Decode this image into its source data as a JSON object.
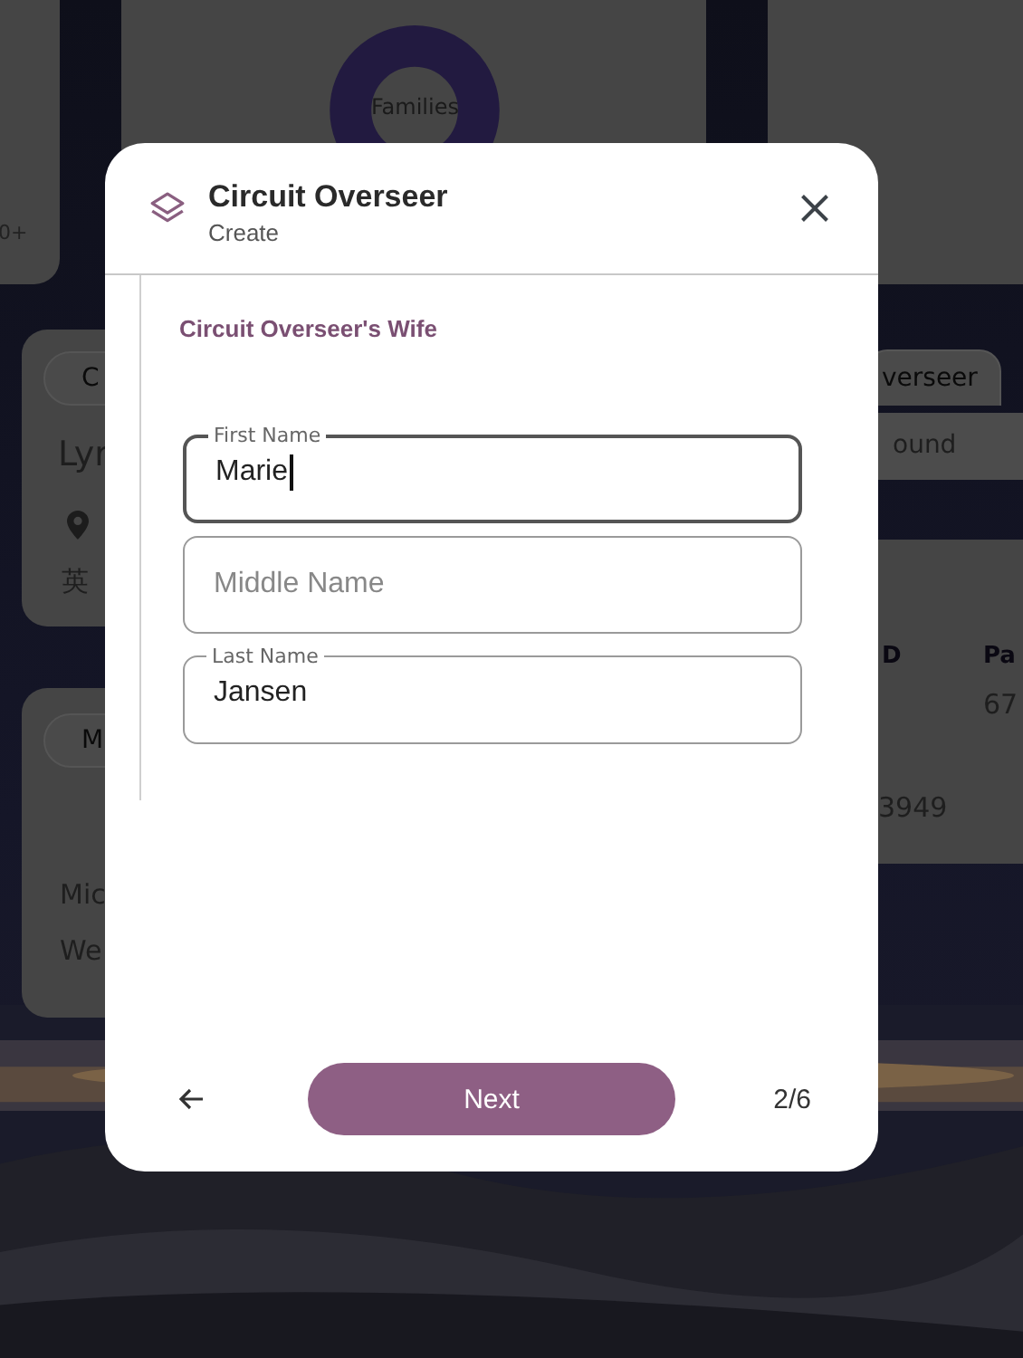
{
  "background": {
    "count_tile": "0+",
    "families_chart_label": "Families",
    "person_card": {
      "chip": "C",
      "name": "Lyr",
      "language": "英"
    },
    "member_card": {
      "chip": "M",
      "lines": [
        "Mic",
        "We"
      ]
    },
    "overseer_panel": {
      "tab": "verseer",
      "row": "ound"
    },
    "table": {
      "columns": [
        "D",
        "Pa"
      ],
      "cells": [
        "67",
        "3949"
      ]
    }
  },
  "dialog": {
    "title": "Circuit Overseer",
    "subtitle": "Create",
    "section": "Circuit Overseer's Wife",
    "fields": [
      {
        "label": "First Name",
        "value": "Marie",
        "focused": true
      },
      {
        "placeholder": "Middle Name",
        "focused": false
      },
      {
        "label": "Last Name",
        "value": "Jansen",
        "focused": false
      }
    ],
    "next_button": "Next",
    "step": "2/6"
  }
}
